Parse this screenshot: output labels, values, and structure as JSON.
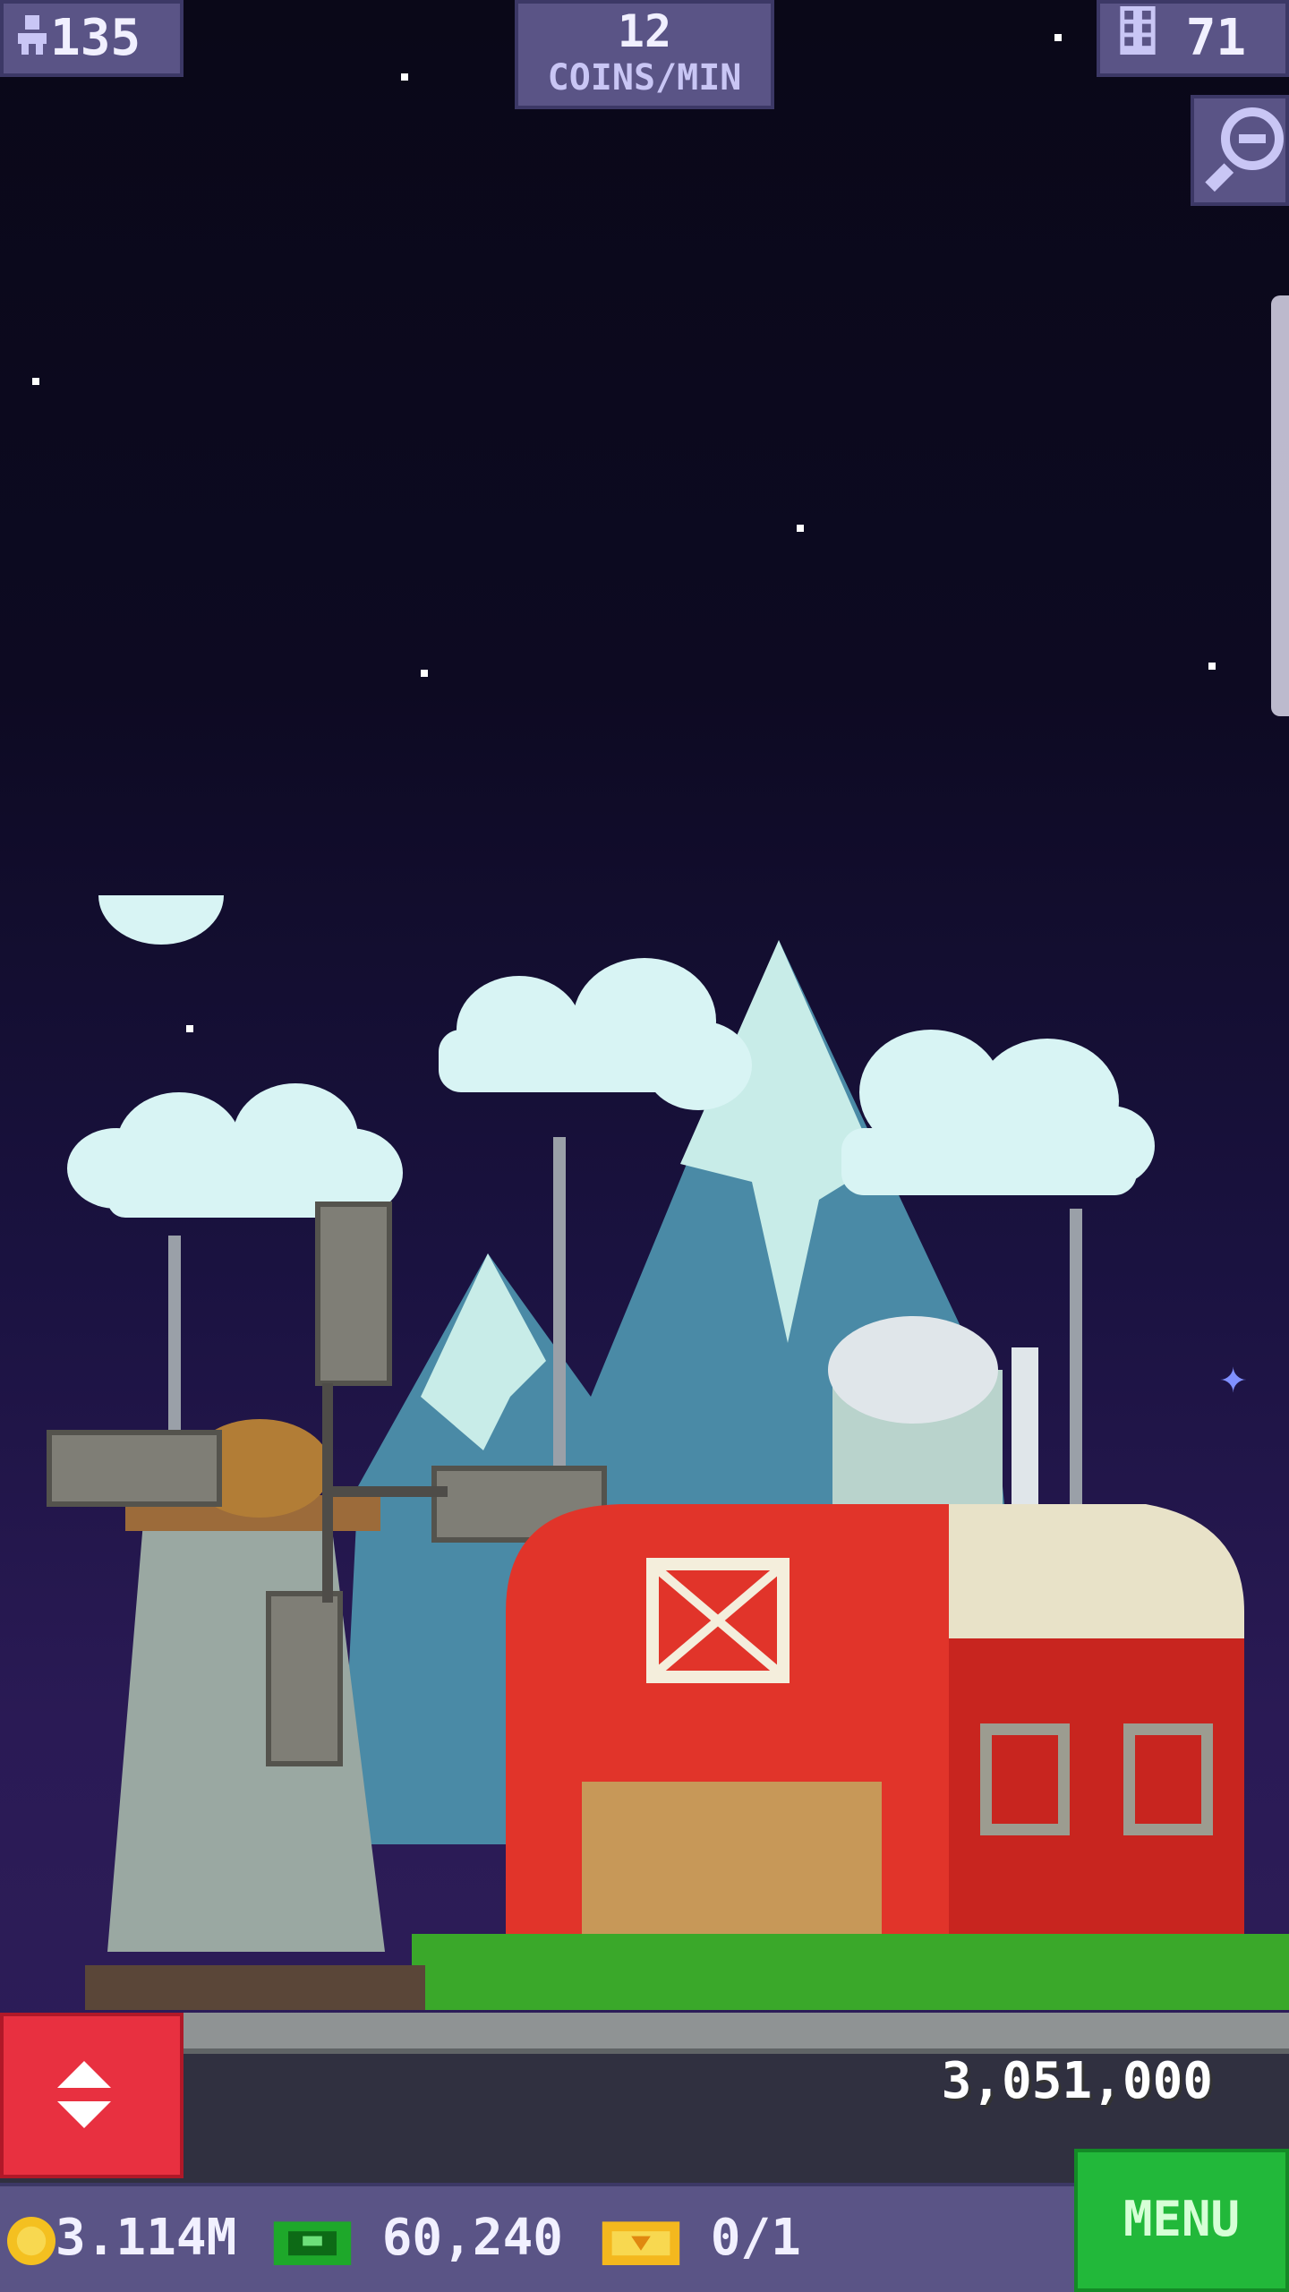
{
  "hud": {
    "population": "135",
    "coins_rate_value": "12",
    "coins_rate_label": "COINS/MIN",
    "floors": "71"
  },
  "floor_price": "3,051,000",
  "resources": {
    "coins": "3.114M",
    "bux": "60,240",
    "tickets": "0/1"
  },
  "menu_label": "MENU",
  "colors": {
    "hud_bg": "#5a5486",
    "menu_green": "#22b83a",
    "elevator_red": "#e83040",
    "barn_red": "#e1342a"
  },
  "icons": {
    "population": "person-icon",
    "floors": "building-icon",
    "zoom": "zoom-out-icon",
    "elevator": "up-down-arrows-icon",
    "coins": "coin-icon",
    "bux": "cash-icon",
    "tickets": "ticket-icon"
  }
}
